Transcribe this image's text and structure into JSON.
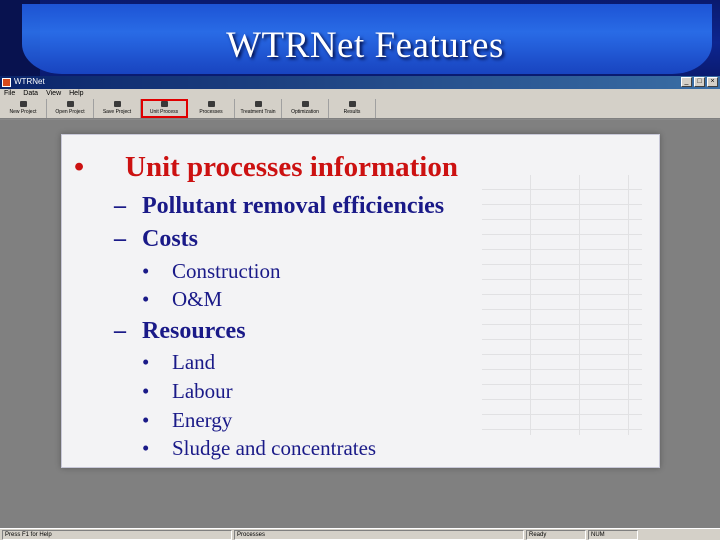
{
  "slide": {
    "title": "WTRNet Features"
  },
  "app": {
    "window_title": "WTRNet",
    "menu": [
      "File",
      "Data",
      "View",
      "Help"
    ],
    "toolbar": [
      {
        "label": "New Project",
        "icon": "new-icon"
      },
      {
        "label": "Open Project",
        "icon": "open-icon"
      },
      {
        "label": "Save Project",
        "icon": "save-icon"
      },
      {
        "label": "Unit Process",
        "icon": "unit-process-icon",
        "selected": true
      },
      {
        "label": "Processes",
        "icon": "processes-icon"
      },
      {
        "label": "Treatment Train",
        "icon": "treatment-train-icon"
      },
      {
        "label": "Optimization",
        "icon": "optimization-icon"
      },
      {
        "label": "Results",
        "icon": "results-icon"
      }
    ],
    "status": [
      "Press F1 for Help",
      "Processes",
      "Ready",
      "NUM"
    ],
    "colors": {
      "accent": "#cc1111",
      "text": "#1a1a88",
      "title_bar": "#0a246a"
    }
  },
  "content": {
    "heading": {
      "marker": "•",
      "text": "Unit processes information"
    },
    "items": [
      {
        "marker": "–",
        "text": "Pollutant removal efficiencies"
      },
      {
        "marker": "–",
        "text": "Costs"
      },
      {
        "marker": "•",
        "text": "Construction"
      },
      {
        "marker": "•",
        "text": "O&M"
      },
      {
        "marker": "–",
        "text": "Resources"
      },
      {
        "marker": "•",
        "text": "Land"
      },
      {
        "marker": "•",
        "text": "Labour"
      },
      {
        "marker": "•",
        "text": "Energy"
      },
      {
        "marker": "•",
        "text": "Sludge and concentrates"
      }
    ]
  }
}
